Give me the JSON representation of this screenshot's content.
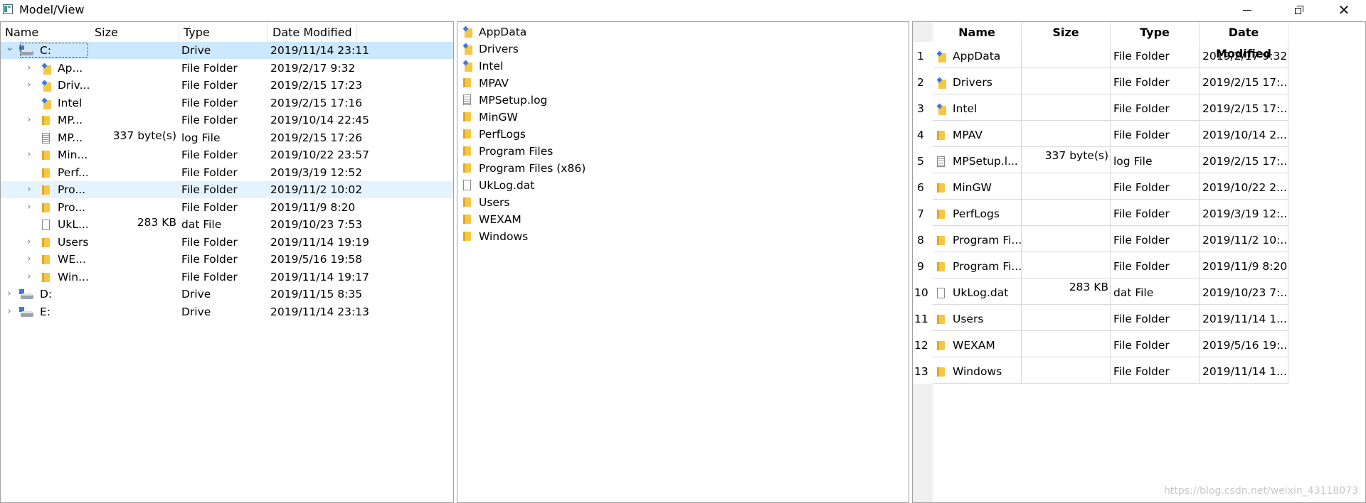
{
  "window": {
    "title": "Model/View"
  },
  "tree": {
    "headers": [
      "Name",
      "Size",
      "Type",
      "Date Modified"
    ],
    "rows": [
      {
        "name": "C:",
        "size": "",
        "type": "Drive",
        "date": "2019/11/14 23:11",
        "icon": "drive-icon",
        "expander": "expanded",
        "level": 0
      },
      {
        "name": "Ap...",
        "size": "",
        "type": "File Folder",
        "date": "2019/2/17 9:32",
        "icon": "system-folder-icon",
        "expander": "collapsed",
        "level": 1
      },
      {
        "name": "Driv...",
        "size": "",
        "type": "File Folder",
        "date": "2019/2/15 17:23",
        "icon": "system-folder-icon",
        "expander": "collapsed",
        "level": 1
      },
      {
        "name": "Intel",
        "size": "",
        "type": "File Folder",
        "date": "2019/2/15 17:16",
        "icon": "system-folder-icon",
        "expander": "none",
        "level": 1
      },
      {
        "name": "MP...",
        "size": "",
        "type": "File Folder",
        "date": "2019/10/14 22:45",
        "icon": "folder-icon",
        "expander": "collapsed",
        "level": 1
      },
      {
        "name": "MP...",
        "size": "337 byte(s)",
        "type": "log File",
        "date": "2019/2/15 17:26",
        "icon": "log-file-icon",
        "expander": "none",
        "level": 1
      },
      {
        "name": "Min...",
        "size": "",
        "type": "File Folder",
        "date": "2019/10/22 23:57",
        "icon": "folder-icon",
        "expander": "collapsed",
        "level": 1
      },
      {
        "name": "Perf...",
        "size": "",
        "type": "File Folder",
        "date": "2019/3/19 12:52",
        "icon": "folder-icon",
        "expander": "none",
        "level": 1
      },
      {
        "name": "Pro...",
        "size": "",
        "type": "File Folder",
        "date": "2019/11/2 10:02",
        "icon": "folder-icon",
        "expander": "collapsed",
        "level": 1
      },
      {
        "name": "Pro...",
        "size": "",
        "type": "File Folder",
        "date": "2019/11/9 8:20",
        "icon": "folder-icon",
        "expander": "collapsed",
        "level": 1
      },
      {
        "name": "UkL...",
        "size": "283 KB",
        "type": "dat File",
        "date": "2019/10/23 7:53",
        "icon": "file-icon",
        "expander": "none",
        "level": 1
      },
      {
        "name": "Users",
        "size": "",
        "type": "File Folder",
        "date": "2019/11/14 19:19",
        "icon": "folder-icon",
        "expander": "collapsed",
        "level": 1
      },
      {
        "name": "WE...",
        "size": "",
        "type": "File Folder",
        "date": "2019/5/16 19:58",
        "icon": "folder-icon",
        "expander": "collapsed",
        "level": 1
      },
      {
        "name": "Win...",
        "size": "",
        "type": "File Folder",
        "date": "2019/11/14 19:17",
        "icon": "folder-icon",
        "expander": "collapsed",
        "level": 1
      },
      {
        "name": "D:",
        "size": "",
        "type": "Drive",
        "date": "2019/11/15 8:35",
        "icon": "drive-icon",
        "expander": "collapsed",
        "level": 0
      },
      {
        "name": "E:",
        "size": "",
        "type": "Drive",
        "date": "2019/11/14 23:13",
        "icon": "drive-icon",
        "expander": "collapsed",
        "level": 0
      }
    ]
  },
  "list": {
    "items": [
      {
        "name": "AppData",
        "icon": "system-folder-icon"
      },
      {
        "name": "Drivers",
        "icon": "system-folder-icon"
      },
      {
        "name": "Intel",
        "icon": "system-folder-icon"
      },
      {
        "name": "MPAV",
        "icon": "folder-icon"
      },
      {
        "name": "MPSetup.log",
        "icon": "log-file-icon"
      },
      {
        "name": "MinGW",
        "icon": "folder-icon"
      },
      {
        "name": "PerfLogs",
        "icon": "folder-icon"
      },
      {
        "name": "Program Files",
        "icon": "folder-icon"
      },
      {
        "name": "Program Files (x86)",
        "icon": "folder-icon"
      },
      {
        "name": "UkLog.dat",
        "icon": "file-icon"
      },
      {
        "name": "Users",
        "icon": "folder-icon"
      },
      {
        "name": "WEXAM",
        "icon": "folder-icon"
      },
      {
        "name": "Windows",
        "icon": "folder-icon"
      }
    ]
  },
  "table": {
    "headers": [
      "Name",
      "Size",
      "Type",
      "Date Modified"
    ],
    "rows": [
      {
        "num": "1",
        "name": "AppData",
        "size": "",
        "type": "File Folder",
        "date": "2019/2/17 9:32",
        "icon": "system-folder-icon"
      },
      {
        "num": "2",
        "name": "Drivers",
        "size": "",
        "type": "File Folder",
        "date": "2019/2/15 17:...",
        "icon": "system-folder-icon"
      },
      {
        "num": "3",
        "name": "Intel",
        "size": "",
        "type": "File Folder",
        "date": "2019/2/15 17:...",
        "icon": "system-folder-icon"
      },
      {
        "num": "4",
        "name": "MPAV",
        "size": "",
        "type": "File Folder",
        "date": "2019/10/14 2...",
        "icon": "folder-icon"
      },
      {
        "num": "5",
        "name": "MPSetup.l...",
        "size": "337 byte(s)",
        "type": "log File",
        "date": "2019/2/15 17:...",
        "icon": "log-file-icon"
      },
      {
        "num": "6",
        "name": "MinGW",
        "size": "",
        "type": "File Folder",
        "date": "2019/10/22 2...",
        "icon": "folder-icon"
      },
      {
        "num": "7",
        "name": "PerfLogs",
        "size": "",
        "type": "File Folder",
        "date": "2019/3/19 12:...",
        "icon": "folder-icon"
      },
      {
        "num": "8",
        "name": "Program Fi...",
        "size": "",
        "type": "File Folder",
        "date": "2019/11/2 10:...",
        "icon": "folder-icon"
      },
      {
        "num": "9",
        "name": "Program Fi...",
        "size": "",
        "type": "File Folder",
        "date": "2019/11/9 8:20",
        "icon": "folder-icon"
      },
      {
        "num": "10",
        "name": "UkLog.dat",
        "size": "283 KB",
        "type": "dat File",
        "date": "2019/10/23 7:...",
        "icon": "file-icon"
      },
      {
        "num": "11",
        "name": "Users",
        "size": "",
        "type": "File Folder",
        "date": "2019/11/14 1...",
        "icon": "folder-icon"
      },
      {
        "num": "12",
        "name": "WEXAM",
        "size": "",
        "type": "File Folder",
        "date": "2019/5/16 19:...",
        "icon": "folder-icon"
      },
      {
        "num": "13",
        "name": "Windows",
        "size": "",
        "type": "File Folder",
        "date": "2019/11/14 1...",
        "icon": "folder-icon"
      }
    ]
  },
  "watermark": "https://blog.csdn.net/weixin_43118073"
}
